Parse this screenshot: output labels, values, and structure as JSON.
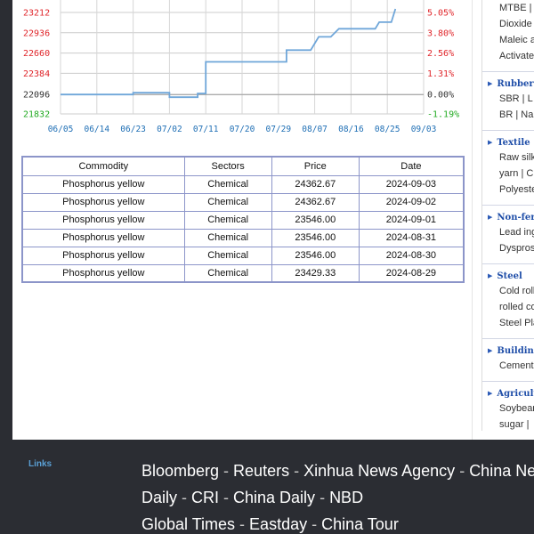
{
  "chart_data": {
    "type": "line",
    "y_left_ticks": [
      "23212",
      "22936",
      "22660",
      "22384",
      "22096",
      "21832"
    ],
    "y_left_colors": [
      "#e0262b",
      "#e0262b",
      "#e0262b",
      "#e0262b",
      "#333333",
      "#22aa22"
    ],
    "y_right_ticks": [
      "5.05%",
      "3.80%",
      "2.56%",
      "1.31%",
      "0.00%",
      "-1.19%"
    ],
    "y_right_colors": [
      "#e0262b",
      "#e0262b",
      "#e0262b",
      "#e0262b",
      "#333333",
      "#22aa22"
    ],
    "x_ticks": [
      "06/05",
      "06/14",
      "06/23",
      "07/02",
      "07/11",
      "07/20",
      "07/29",
      "08/07",
      "08/16",
      "08/25",
      "09/03"
    ],
    "ylim": [
      21832,
      23212
    ],
    "baseline": 22096,
    "grid": true,
    "series": [
      {
        "color": "#6fa6d9",
        "points": [
          [
            "06/05",
            22096
          ],
          [
            "06/23",
            22096
          ],
          [
            "06/23",
            22120
          ],
          [
            "07/02",
            22120
          ],
          [
            "07/02",
            22060
          ],
          [
            "07/09",
            22060
          ],
          [
            "07/09",
            22110
          ],
          [
            "07/11",
            22110
          ],
          [
            "07/11",
            22540
          ],
          [
            "07/31",
            22540
          ],
          [
            "07/31",
            22700
          ],
          [
            "08/06",
            22700
          ],
          [
            "08/08",
            22880
          ],
          [
            "08/11",
            22880
          ],
          [
            "08/13",
            22990
          ],
          [
            "08/22",
            22990
          ],
          [
            "08/23",
            23080
          ],
          [
            "08/26",
            23080
          ],
          [
            "08/27",
            23260
          ]
        ]
      }
    ]
  },
  "table": {
    "headers": [
      "Commodity",
      "Sectors",
      "Price",
      "Date"
    ],
    "rows": [
      [
        "Phosphorus yellow",
        "Chemical",
        "24362.67",
        "2024-09-03"
      ],
      [
        "Phosphorus yellow",
        "Chemical",
        "24362.67",
        "2024-09-02"
      ],
      [
        "Phosphorus yellow",
        "Chemical",
        "23546.00",
        "2024-09-01"
      ],
      [
        "Phosphorus yellow",
        "Chemical",
        "23546.00",
        "2024-08-31"
      ],
      [
        "Phosphorus yellow",
        "Chemical",
        "23546.00",
        "2024-08-30"
      ],
      [
        "Phosphorus yellow",
        "Chemical",
        "23429.33",
        "2024-08-29"
      ]
    ]
  },
  "sidebar": {
    "categories": [
      {
        "title": "",
        "lines": [
          "MTBE |",
          "Dioxide",
          "Maleic a",
          "Activate"
        ]
      },
      {
        "title": "Rubber",
        "lines": [
          "SBR | L",
          "BR | Na"
        ]
      },
      {
        "title": "Textile",
        "lines": [
          "Raw silk",
          "yarn | C",
          "Polyeste"
        ]
      },
      {
        "title": "Non-ferr",
        "lines": [
          "Lead ing",
          "Dyspros"
        ]
      },
      {
        "title": "Steel",
        "lines": [
          "Cold roll",
          "rolled co",
          "Steel Pla"
        ]
      },
      {
        "title": "Building",
        "lines": [
          "Cement"
        ]
      },
      {
        "title": "Agricult",
        "lines": [
          "Soybear",
          "sugar |"
        ]
      }
    ]
  },
  "footer": {
    "label": "Links",
    "links": [
      "Bloomberg",
      "Reuters",
      "Xinhua News Agency",
      "China Ne",
      "Daily",
      "CRI",
      "China Daily",
      "NBD",
      "Global Times",
      "Eastday",
      "China Tour"
    ],
    "separator": " - "
  }
}
